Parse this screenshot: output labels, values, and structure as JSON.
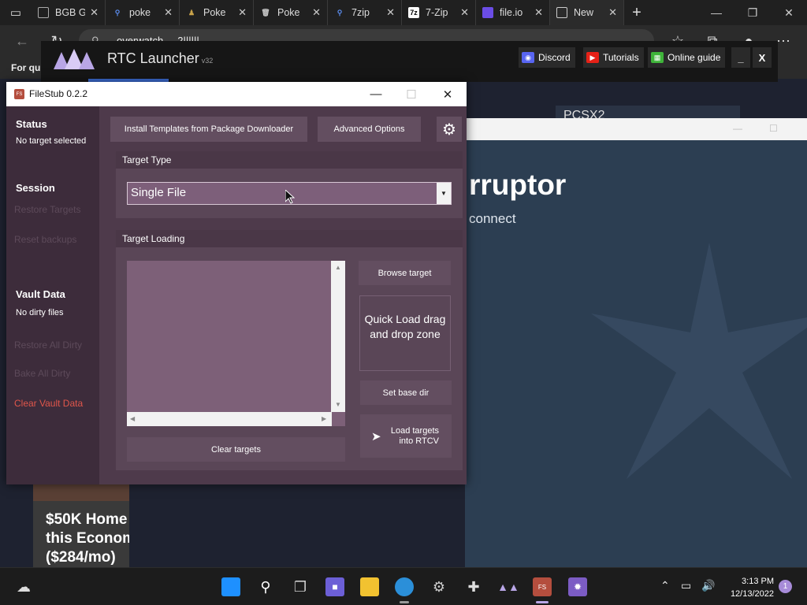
{
  "browser": {
    "tabs": [
      {
        "label": "BGB G",
        "fav": "doc"
      },
      {
        "label": "poke",
        "fav": "search"
      },
      {
        "label": "Poke",
        "fav": "pokemon"
      },
      {
        "label": "Poke",
        "fav": "trash"
      },
      {
        "label": "7zip",
        "fav": "search"
      },
      {
        "label": "7-Zip",
        "fav": "7zip"
      },
      {
        "label": "file.io",
        "fav": "fileio"
      },
      {
        "label": "New",
        "fav": "newtab"
      }
    ],
    "address_text": "overwatch ... 2||||||",
    "favorites_label": "For qui"
  },
  "launcher": {
    "title": "RTC Launcher",
    "version": "v32",
    "buttons": {
      "discord": "Discord",
      "tutorials": "Tutorials",
      "guide": "Online guide"
    },
    "minimize": "_",
    "close": "X"
  },
  "webpage": {
    "heading": "rruptor",
    "subtext": "connect",
    "pcsx": "PCSX2",
    "ad_text": "$50K Home\nthis Econom\n($284/mo)",
    "ad_lines": [
      "$50K Home",
      "this Econom",
      "($284/mo)"
    ]
  },
  "filestub": {
    "title": "FileStub 0.2.2",
    "sidebar": {
      "status_heading": "Status",
      "status_text": "No target selected",
      "session_heading": "Session",
      "restore_targets": "Restore Targets",
      "reset_backups": "Reset backups",
      "vault_heading": "Vault Data",
      "vault_text": "No dirty files",
      "restore_all_dirty": "Restore All Dirty",
      "bake_all_dirty": "Bake All Dirty",
      "clear_vault": "Clear Vault Data"
    },
    "top_buttons": {
      "install_templates": "Install Templates from Package Downloader",
      "advanced_options": "Advanced Options"
    },
    "target_type": {
      "header": "Target Type",
      "selected": "Single File"
    },
    "target_loading": {
      "header": "Target Loading",
      "browse": "Browse target",
      "dropzone": "Quick Load drag and drop zone",
      "set_base_dir": "Set base dir",
      "load_targets": "Load targets into RTCV",
      "clear_targets": "Clear targets"
    }
  },
  "taskbar": {
    "time": "3:13 PM",
    "date": "12/13/2022",
    "notifications": "1"
  }
}
